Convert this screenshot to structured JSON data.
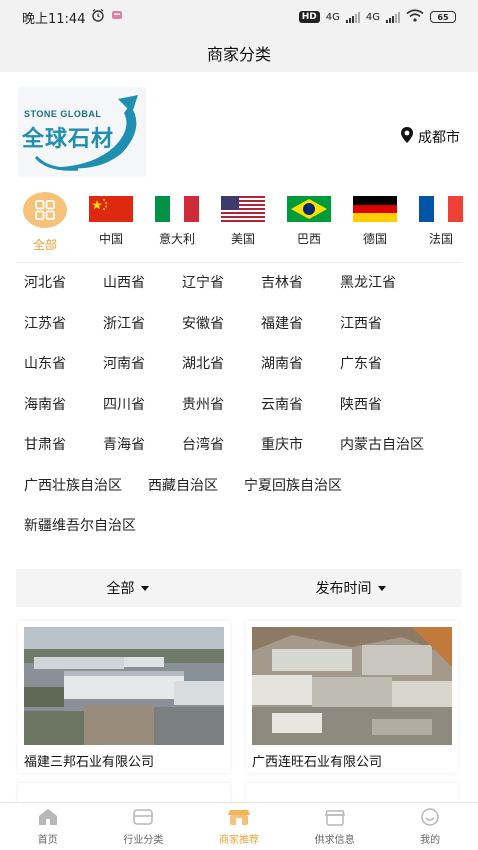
{
  "status_bar": {
    "time": "晚上11:44",
    "hd": "HD",
    "net1": "4G",
    "net2": "4G",
    "battery": "65"
  },
  "header": {
    "title": "商家分类"
  },
  "brand": {
    "logo_en": "STONE GLOBAL",
    "logo_cn": "全球石材",
    "city": "成都市"
  },
  "countries": [
    {
      "label": "全部",
      "icon": "grid-icon",
      "active": true
    },
    {
      "label": "中国",
      "icon": "china-flag-icon"
    },
    {
      "label": "意大利",
      "icon": "italy-flag-icon"
    },
    {
      "label": "美国",
      "icon": "usa-flag-icon"
    },
    {
      "label": "巴西",
      "icon": "brazil-flag-icon"
    },
    {
      "label": "德国",
      "icon": "germany-flag-icon"
    },
    {
      "label": "法国",
      "icon": "france-flag-icon"
    }
  ],
  "regions": [
    "河北省",
    "山西省",
    "辽宁省",
    "吉林省",
    "黑龙江省",
    "江苏省",
    "浙江省",
    "安徽省",
    "福建省",
    "江西省",
    "山东省",
    "河南省",
    "湖北省",
    "湖南省",
    "广东省",
    "海南省",
    "四川省",
    "贵州省",
    "云南省",
    "陕西省",
    "甘肃省",
    "青海省",
    "台湾省",
    "重庆市",
    "内蒙古自治区",
    "广西壮族自治区",
    "西藏自治区",
    "宁夏回族自治区",
    "新疆维吾尔自治区"
  ],
  "filters": {
    "category": "全部",
    "sort": "发布时间"
  },
  "companies": [
    {
      "name": "福建三邦石业有限公司"
    },
    {
      "name": "广西连旺石业有限公司"
    }
  ],
  "tabs": [
    {
      "label": "首页",
      "icon": "home-icon"
    },
    {
      "label": "行业分类",
      "icon": "category-icon"
    },
    {
      "label": "商家推荐",
      "icon": "shop-icon",
      "active": true
    },
    {
      "label": "供求信息",
      "icon": "supply-icon"
    },
    {
      "label": "我的",
      "icon": "profile-icon"
    }
  ],
  "colors": {
    "accent": "#e8a23a",
    "accent_light": "#f6c27a",
    "logo_blue": "#1e8fb0"
  }
}
